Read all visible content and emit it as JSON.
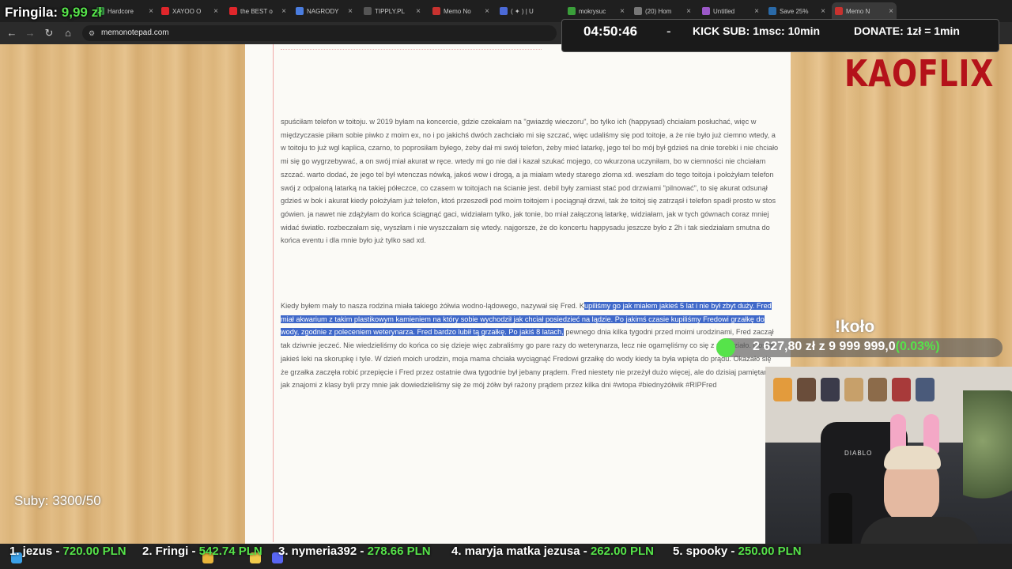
{
  "browser": {
    "tabs": [
      {
        "label": "Hardcore",
        "color": "#3b9e4a"
      },
      {
        "label": "XAYOO O",
        "color": "#e0262b"
      },
      {
        "label": "the BEST o",
        "color": "#e0262b"
      },
      {
        "label": "NAGRODY",
        "color": "#4a7de0"
      },
      {
        "label": "TIPPLY.PL",
        "color": "#2c2c2c"
      },
      {
        "label": "Memo No",
        "color": "#c8322f"
      },
      {
        "label": "( ✦ ) | U",
        "color": "#4b6ad8"
      },
      {
        "label": "mokrysuc",
        "color": "#3a9f3a"
      },
      {
        "label": "(20) Hom",
        "color": "#777777"
      },
      {
        "label": "Untitled",
        "color": "#9b58c8"
      },
      {
        "label": "Save 25%",
        "color": "#2a6aa8"
      },
      {
        "label": "Memo N",
        "color": "#c8322f"
      }
    ],
    "url": "memonotepad.com"
  },
  "notepad": {
    "para1": "spuściłam telefon w toitoju. w 2019 byłam na koncercie, gdzie czekałam na \"gwiazdę wieczoru\", bo tylko ich (happysad) chciałam posłuchać, więc w międzyczasie piłam sobie piwko z moim ex, no i po jakichś dwóch zachciało mi się szczać, więc udaliśmy się pod toitoje, a że nie było już ciemno wtedy, a w toitoju to już wgl kaplica, czarno, to poprosiłam byłego, żeby dał mi swój telefon, żeby mieć latarkę, jego tel bo mój był gdzieś na dnie torebki i nie chciało mi się go wygrzebywać, a on swój miał akurat w ręce. wtedy mi go nie dał i kazał szukać mojego, co wkurzona uczyniłam, bo w ciemności nie chciałam szczać. warto dodać, że jego tel był wtenczas nówką, jakoś wow i drogą, a ja miałam wtedy starego złoma xd. weszłam do tego toitoja i położyłam telefon swój z odpaloną latarką na takiej półeczce, co czasem w toitojach na ścianie jest. debil były zamiast stać pod drzwiami \"pilnować\", to się akurat odsunął gdzieś w bok i akurat kiedy położyłam już telefon, ktoś przeszedł pod moim toitojem i pociągnął drzwi, tak że toitoj się zatrząsł i telefon spadł prosto w stos gówien. ja nawet nie zdążyłam do końca ściągnąć gaci, widziałam tylko, jak tonie, bo miał załączoną latarkę, widziałam, jak w tych gównach coraz mniej widać światło. rozbeczałam się, wyszłam i nie wyszczałam się wtedy. najgorsze, że do koncertu happysadu jeszcze było z 2h i tak siedziałam smutna do końca eventu i dla mnie było już tylko sad xd.",
    "para2_plain_start": "Kiedy byłem mały to nasza rodzina miała takiego żółwia wodno-lądowego, nazywał się Fred. K",
    "para2_highlight": "upiliśmy go jak miałem jakieś 5 lat i nie był zbyt duży. Fred miał akwarium z takim plastikowym kamieniem na który sobie wychodził jak chciał posiedzieć na lądzie. Po jakimś czasie kupiliśmy Fredowi grzałkę do wody, zgodnie z poleceniem weterynarza. Fred bardzo lubił tą grzałkę. Po jakiś 8 latach,",
    "para2_rest": " pewnego dnia kilka tygodni przed moimi urodzinami, Fred zaczął tak dziwnie jeczeć. Nie wiedzieliśmy do końca co się dzieje więc zabraliśmy go pare razy do weterynarza, lecz nie ogarnęliśmy co się z nim działo. Dostał jakieś leki na skorupkę i tyle. W dzień moich urodzin, moja mama chciała wyciągnąć Fredowi grzałkę do wody kiedy ta była wpięta do prądu. Okazało się że grzałka zaczęła robić przepięcie i Fred przez ostatnie dwa tygodnie był jebany prądem. Fred niestety nie przeżył dużo więcej, ale do dzisiaj pamiętam jak znajomi z klasy byli przy mnie jak dowiedzieliśmy się że mój żółw był rażony prądem przez kilka dni #wtopa #biednyżółwik #RIPFred"
  },
  "overlay": {
    "fringila_label": "Fringila:",
    "fringila_value": "9,99 zł",
    "timer": "04:50:46",
    "dash": "-",
    "kick_sub": "KICK SUB: 1msc: 10min",
    "donate": "DONATE: 1zł = 1min",
    "logo": "KAOFLIX",
    "kolo_cmd": "!koło",
    "progress_current": "2 627,80 zł",
    "progress_sep": "z",
    "progress_goal": "9 999 999,0",
    "progress_pct": "(0.03%)",
    "progress_fraction": 0.0003,
    "suby": "Suby: 3300/50",
    "chair_brand": "DIABLO"
  },
  "ticker": [
    {
      "rank": "1. jezus -",
      "amount": "720.00 PLN"
    },
    {
      "rank": "2. Fringi -",
      "amount": "542.74 PLN"
    },
    {
      "rank": "3. nymeria392 -",
      "amount": "278.66 PLN"
    },
    {
      "rank": "4. maryja matka jezusa -",
      "amount": "262.00 PLN"
    },
    {
      "rank": "5. spooky -",
      "amount": "250.00 PLN"
    }
  ],
  "colors": {
    "accent_green": "#56e34a",
    "logo_red": "#b4121a",
    "selection_blue": "#3f68c9"
  }
}
